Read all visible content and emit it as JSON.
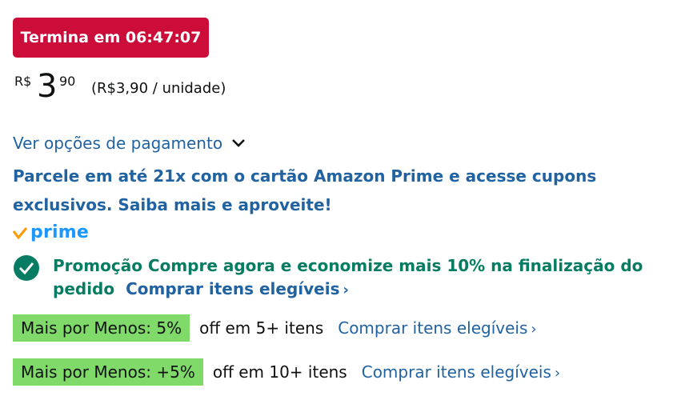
{
  "deal": {
    "countdown": "Termina em 06:47:07"
  },
  "price": {
    "currency": "R$",
    "whole": "3",
    "fraction": "90",
    "unit_price": "(R$3,90 / unidade)"
  },
  "payment": {
    "options_link": "Ver opções de pagamento"
  },
  "prime_promo": {
    "text": "Parcele em até 21x com o cartão Amazon Prime e acesse cupons exclusivos. Saiba mais e aproveite!"
  },
  "prime_badge": {
    "label": "prime"
  },
  "coupon": {
    "text": "Promoção Compre agora e economize mais 10% na finalização do pedido",
    "link": "Comprar itens elegíveis"
  },
  "mais_por_menos": [
    {
      "badge": "Mais por Menos: 5%",
      "desc": "off em 5+ itens",
      "link": "Comprar itens elegíveis"
    },
    {
      "badge": "Mais por Menos: +5%",
      "desc": "off em 10+ itens",
      "link": "Comprar itens elegíveis"
    }
  ],
  "colors": {
    "deal_red": "#cc0c39",
    "link_blue": "#2162a1",
    "promo_green": "#067d62",
    "badge_green": "#7fda69",
    "prime_blue": "#1a98ff",
    "prime_orange": "#ff9900"
  }
}
